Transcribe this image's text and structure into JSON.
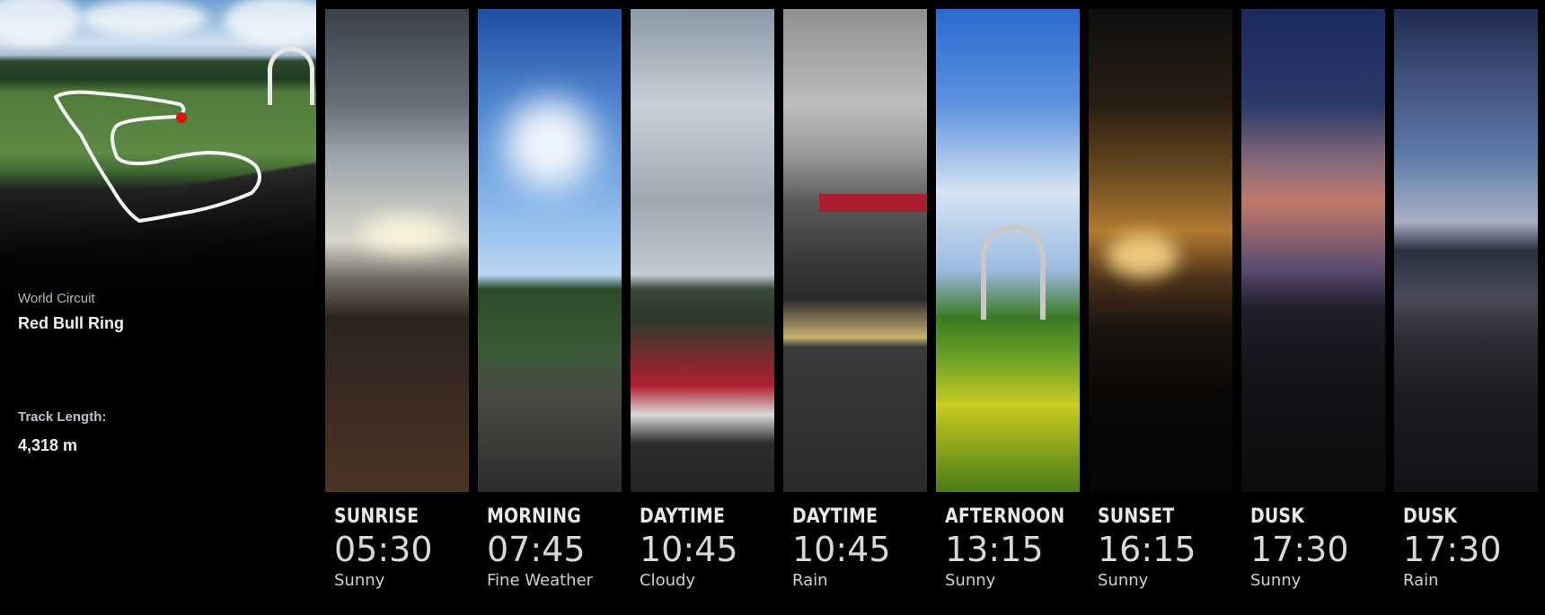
{
  "track": {
    "category": "World Circuit",
    "name": "Red Bull Ring",
    "length_label": "Track Length:",
    "length_value": "4,318 m"
  },
  "navigation": {
    "prev_icon": "chevron-left-icon"
  },
  "time_options": [
    {
      "period": "SUNRISE",
      "time": "05:30",
      "weather": "Sunny"
    },
    {
      "period": "MORNING",
      "time": "07:45",
      "weather": "Fine Weather"
    },
    {
      "period": "DAYTIME",
      "time": "10:45",
      "weather": "Cloudy"
    },
    {
      "period": "DAYTIME",
      "time": "10:45",
      "weather": "Rain"
    },
    {
      "period": "AFTERNOON",
      "time": "13:15",
      "weather": "Sunny"
    },
    {
      "period": "SUNSET",
      "time": "16:15",
      "weather": "Sunny"
    },
    {
      "period": "DUSK",
      "time": "17:30",
      "weather": "Sunny"
    },
    {
      "period": "DUSK",
      "time": "17:30",
      "weather": "Rain"
    }
  ]
}
